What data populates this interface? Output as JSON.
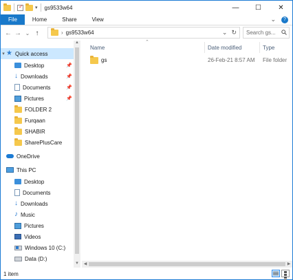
{
  "window": {
    "title": "gs9533w64",
    "controls": {
      "minimize": "—",
      "maximize": "☐",
      "close": "✕"
    }
  },
  "ribbon": {
    "tabs": [
      "File",
      "Home",
      "Share",
      "View"
    ],
    "collapse_glyph": "⌄",
    "help_glyph": "?"
  },
  "address": {
    "crumb": "gs9533w64",
    "separator": "›",
    "dropdown_glyph": "⌄",
    "refresh_glyph": "↻"
  },
  "search": {
    "placeholder": "Search gs...",
    "icon": "search-icon"
  },
  "nav": {
    "back": "←",
    "forward": "→",
    "recent": "⌄",
    "up": "↑",
    "quick_access": "Quick access",
    "quick_items": [
      {
        "label": "Desktop",
        "icon": "desktop-icon",
        "pinned": true
      },
      {
        "label": "Downloads",
        "icon": "download-icon",
        "pinned": true
      },
      {
        "label": "Documents",
        "icon": "documents-icon",
        "pinned": true
      },
      {
        "label": "Pictures",
        "icon": "pictures-icon",
        "pinned": true
      },
      {
        "label": "FOLDER 2",
        "icon": "folder-icon",
        "pinned": false
      },
      {
        "label": "Furqaan",
        "icon": "folder-icon",
        "pinned": false
      },
      {
        "label": "SHABIR",
        "icon": "folder-icon",
        "pinned": false
      },
      {
        "label": "SharePlusCare",
        "icon": "folder-icon",
        "pinned": false
      }
    ],
    "onedrive": "OneDrive",
    "this_pc": "This PC",
    "pc_items": [
      {
        "label": "Desktop",
        "icon": "desktop-icon"
      },
      {
        "label": "Documents",
        "icon": "documents-icon"
      },
      {
        "label": "Downloads",
        "icon": "download-icon"
      },
      {
        "label": "Music",
        "icon": "music-icon"
      },
      {
        "label": "Pictures",
        "icon": "pictures-icon"
      },
      {
        "label": "Videos",
        "icon": "videos-icon"
      },
      {
        "label": "Windows 10 (C:)",
        "icon": "drive-c-icon"
      },
      {
        "label": "Data (D:)",
        "icon": "drive-d-icon"
      }
    ]
  },
  "columns": {
    "name": "Name",
    "date": "Date modified",
    "type": "Type"
  },
  "files": [
    {
      "name": "gs",
      "date": "26-Feb-21 8:57 AM",
      "type": "File folder"
    }
  ],
  "status": {
    "count": "1 item"
  },
  "colors": {
    "accent": "#1979ca",
    "selected": "#cce8ff",
    "folder": "#f5c84c"
  }
}
